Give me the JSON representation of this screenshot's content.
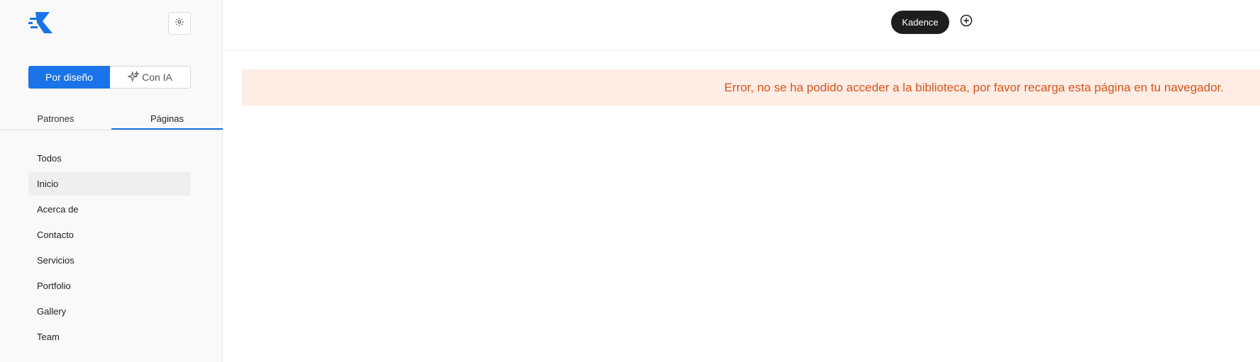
{
  "sidebar": {
    "mode_toggle": {
      "design_label": "Por diseño",
      "ai_label": "Con IA"
    },
    "tabs": [
      {
        "label": "Patrones",
        "active": false
      },
      {
        "label": "Páginas",
        "active": true
      }
    ],
    "pages": [
      {
        "label": "Todos"
      },
      {
        "label": "Inicio",
        "selected": true
      },
      {
        "label": "Acerca de"
      },
      {
        "label": "Contacto"
      },
      {
        "label": "Servicios"
      },
      {
        "label": "Portfolio"
      },
      {
        "label": "Gallery"
      },
      {
        "label": "Team"
      }
    ]
  },
  "header": {
    "library_label": "Kadence"
  },
  "main": {
    "error_message": "Error, no se ha podido acceder a la biblioteca, por favor recarga esta página en tu navegador."
  },
  "colors": {
    "accent": "#1a73e8",
    "error_text": "#d9531a",
    "error_background": "#fdede4",
    "pill_background": "#1e1e1e"
  },
  "icons": {
    "logo": "kadence-logo",
    "settings": "gear-icon",
    "ai": "sparkle-icon",
    "add": "plus-circle-icon"
  }
}
